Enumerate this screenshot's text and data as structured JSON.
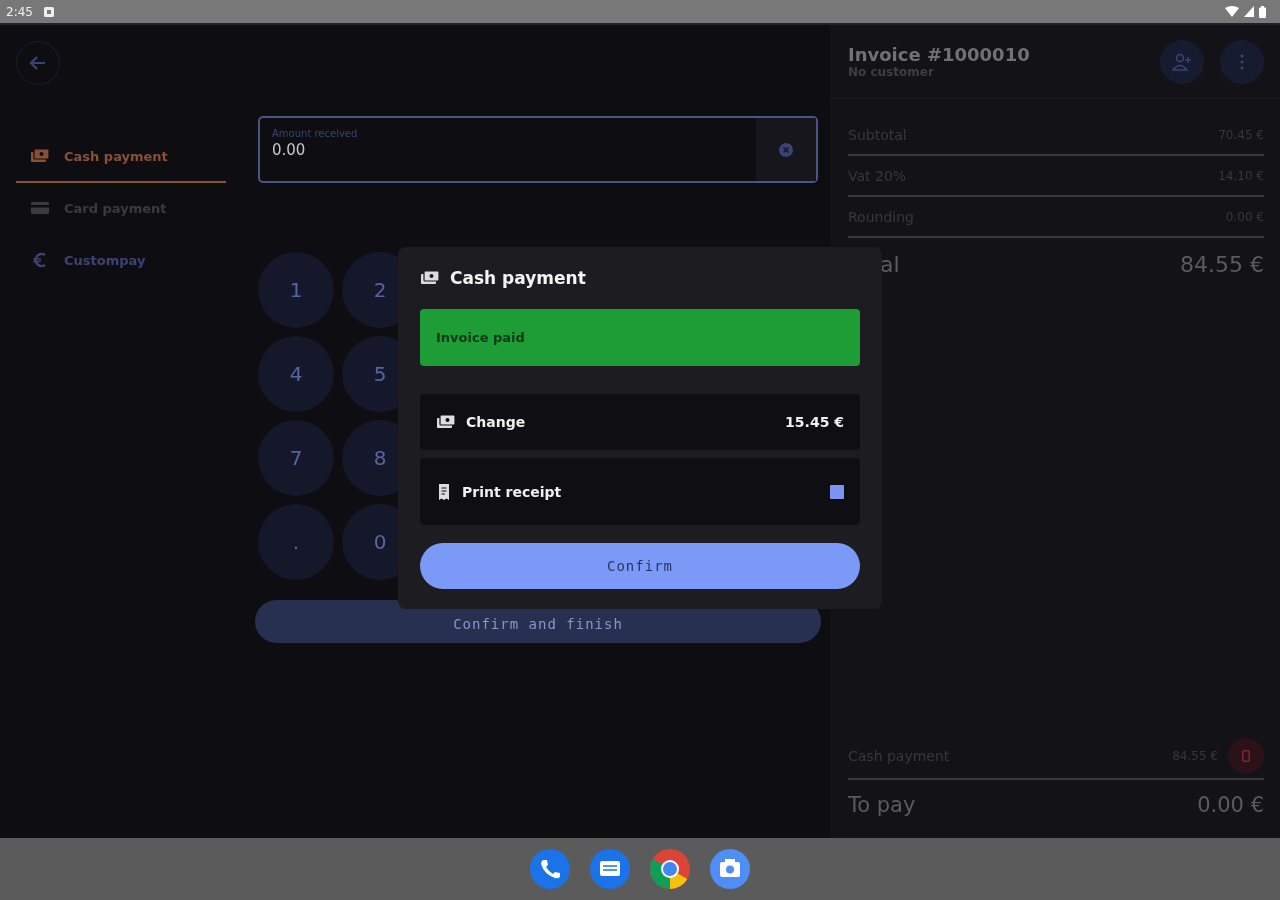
{
  "status_bar": {
    "time": "2:45"
  },
  "sidebar": {
    "payment_methods": [
      {
        "label": "Cash payment",
        "kind": "cash",
        "selected": true,
        "color": "#8a4f35"
      },
      {
        "label": "Card payment",
        "kind": "card",
        "selected": false,
        "color": "#3a3a3f"
      },
      {
        "label": "Custompay",
        "kind": "custom",
        "selected": false,
        "color": "#3b4275"
      }
    ]
  },
  "amount_field": {
    "label": "Amount received",
    "value": "0.00"
  },
  "keypad": {
    "keys": [
      "1",
      "2",
      "4",
      "5",
      "7",
      "8",
      ".",
      "0"
    ]
  },
  "finish_button": "Confirm and finish",
  "invoice": {
    "title": "Invoice #1000010",
    "customer": "No customer",
    "totals": [
      {
        "label": "Subtotal",
        "value": "70.45 €"
      },
      {
        "label": "Vat 20%",
        "value": "14.10 €"
      },
      {
        "label": "Rounding",
        "value": "0.00 €"
      }
    ],
    "total": {
      "label": "al",
      "value": "84.55 €"
    },
    "payments": [
      {
        "label": "Cash payment",
        "value": "84.55 €"
      }
    ],
    "to_pay": {
      "label": "To pay",
      "value": "0.00 €"
    }
  },
  "dialog": {
    "title": "Cash payment",
    "banner": "Invoice paid",
    "change": {
      "label": "Change",
      "value": "15.45 €"
    },
    "print_receipt": {
      "label": "Print receipt",
      "checked": true
    },
    "confirm": "Confirm"
  }
}
